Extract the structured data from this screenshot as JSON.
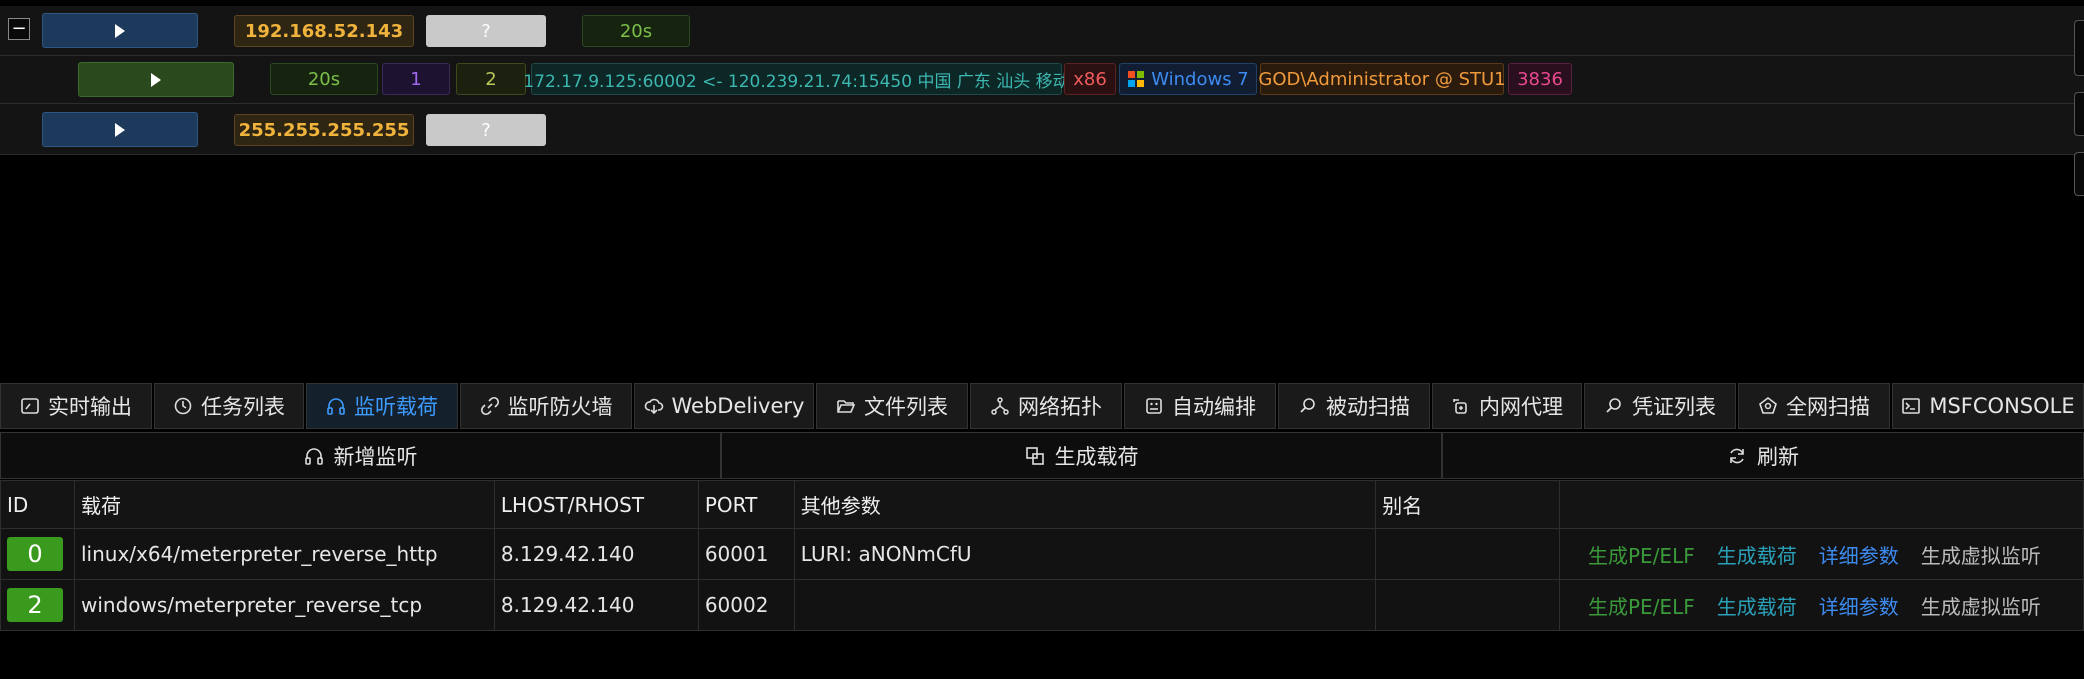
{
  "sessions": [
    {
      "ip": "192.168.52.143",
      "unknown": "?",
      "time": "20s"
    },
    {
      "time": "20s",
      "count_a": "1",
      "count_b": "2",
      "connection": "172.17.9.125:60002 <- 120.239.21.74:15450 中国 广东 汕头 移动",
      "arch": "x86",
      "os": "Windows 7",
      "user": "GOD\\Administrator @ STU1",
      "pid": "3836"
    },
    {
      "ip": "255.255.255.255",
      "unknown": "?"
    }
  ],
  "collapse_glyph": "−",
  "tabs": [
    {
      "label": "实时输出",
      "icon": "gauge-icon"
    },
    {
      "label": "任务列表",
      "icon": "clock-icon"
    },
    {
      "label": "监听载荷",
      "icon": "headphones-icon",
      "active": true
    },
    {
      "label": "监听防火墙",
      "icon": "link-off-icon"
    },
    {
      "label": "WebDelivery",
      "icon": "cloud-download-icon"
    },
    {
      "label": "文件列表",
      "icon": "folder-open-icon"
    },
    {
      "label": "网络拓扑",
      "icon": "topology-icon"
    },
    {
      "label": "自动编排",
      "icon": "robot-icon"
    },
    {
      "label": "被动扫描",
      "icon": "search-file-icon"
    },
    {
      "label": "内网代理",
      "icon": "proxy-icon"
    },
    {
      "label": "凭证列表",
      "icon": "search-icon"
    },
    {
      "label": "全网扫描",
      "icon": "radar-icon"
    },
    {
      "label": "MSFCONSOLE",
      "icon": "terminal-icon"
    }
  ],
  "actions": {
    "add": "新增监听",
    "generate": "生成载荷",
    "refresh": "刷新"
  },
  "table": {
    "headers": [
      "ID",
      "载荷",
      "LHOST/RHOST",
      "PORT",
      "其他参数",
      "别名"
    ],
    "rows": [
      {
        "id": "0",
        "payload": "linux/x64/meterpreter_reverse_http",
        "host": "8.129.42.140",
        "port": "60001",
        "params": "LURI: aNONmCfU",
        "alias": ""
      },
      {
        "id": "2",
        "payload": "windows/meterpreter_reverse_tcp",
        "host": "8.129.42.140",
        "port": "60002",
        "params": "",
        "alias": ""
      }
    ],
    "row_actions": [
      "生成PE/ELF",
      "生成载荷",
      "详细参数",
      "生成虚拟监听"
    ]
  },
  "colors": {
    "accent": "#3d9bff",
    "id_badge": "#3a9a1e",
    "ip_text": "#f0b43c"
  }
}
